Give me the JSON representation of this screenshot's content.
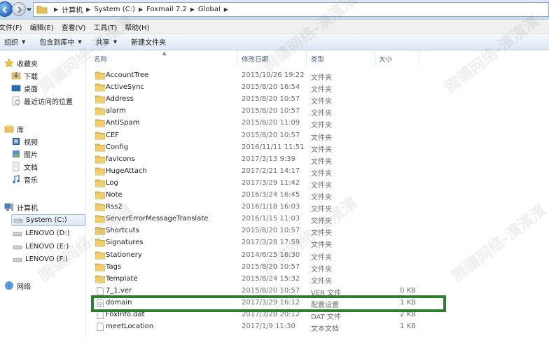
{
  "address": {
    "crumbs": [
      "计算机",
      "System (C:)",
      "Foxmail 7.2",
      "Global"
    ]
  },
  "menu": {
    "items": [
      "文件(F)",
      "编辑(E)",
      "查看(V)",
      "工具(T)",
      "帮助(H)"
    ]
  },
  "toolbar": {
    "organize": "组织",
    "include_library": "包含到库中",
    "share": "共享",
    "new_folder": "新建文件夹"
  },
  "nav": {
    "favorites": "收藏夹",
    "downloads": "下载",
    "desktop": "桌面",
    "recent": "最近访问的位置",
    "libraries": "库",
    "videos": "视频",
    "pictures": "图片",
    "documents": "文档",
    "music": "音乐",
    "computer": "计算机",
    "drive_c": "System (C:)",
    "drive_d": "LENOVO (D:)",
    "drive_e": "LENOVO (E:)",
    "drive_f": "LENOVO (F:)",
    "network": "网络"
  },
  "columns": {
    "name": "名称",
    "modified": "修改日期",
    "type": "类型",
    "size": "大小"
  },
  "files": [
    {
      "name": "AccountTree",
      "date": "2015/10/26 19:22",
      "type": "文件夹",
      "size": "",
      "kind": "folder"
    },
    {
      "name": "ActiveSync",
      "date": "2015/8/20 16:54",
      "type": "文件夹",
      "size": "",
      "kind": "folder"
    },
    {
      "name": "Address",
      "date": "2015/8/20 10:57",
      "type": "文件夹",
      "size": "",
      "kind": "folder"
    },
    {
      "name": "alarm",
      "date": "2015/8/20 10:57",
      "type": "文件夹",
      "size": "",
      "kind": "folder"
    },
    {
      "name": "AntiSpam",
      "date": "2015/8/20 11:09",
      "type": "文件夹",
      "size": "",
      "kind": "folder"
    },
    {
      "name": "CEF",
      "date": "2015/8/20 10:57",
      "type": "文件夹",
      "size": "",
      "kind": "folder"
    },
    {
      "name": "Config",
      "date": "2016/11/11 11:51",
      "type": "文件夹",
      "size": "",
      "kind": "folder"
    },
    {
      "name": "favIcons",
      "date": "2017/3/13 9:39",
      "type": "文件夹",
      "size": "",
      "kind": "folder"
    },
    {
      "name": "HugeAttach",
      "date": "2017/2/21 14:17",
      "type": "文件夹",
      "size": "",
      "kind": "folder"
    },
    {
      "name": "Log",
      "date": "2017/3/29 11:42",
      "type": "文件夹",
      "size": "",
      "kind": "folder"
    },
    {
      "name": "Note",
      "date": "2016/3/24 16:45",
      "type": "文件夹",
      "size": "",
      "kind": "folder"
    },
    {
      "name": "Rss2",
      "date": "2016/1/18 16:03",
      "type": "文件夹",
      "size": "",
      "kind": "folder"
    },
    {
      "name": "ServerErrorMessageTranslate",
      "date": "2016/1/15 11:03",
      "type": "文件夹",
      "size": "",
      "kind": "folder"
    },
    {
      "name": "Shortcuts",
      "date": "2015/8/20 10:57",
      "type": "文件夹",
      "size": "",
      "kind": "folder"
    },
    {
      "name": "Signatures",
      "date": "2017/3/28 17:59",
      "type": "文件夹",
      "size": "",
      "kind": "folder"
    },
    {
      "name": "Stationery",
      "date": "2014/6/25 16:30",
      "type": "文件夹",
      "size": "",
      "kind": "folder"
    },
    {
      "name": "Tags",
      "date": "2015/8/20 10:57",
      "type": "文件夹",
      "size": "",
      "kind": "folder"
    },
    {
      "name": "Template",
      "date": "2015/8/24 15:32",
      "type": "文件夹",
      "size": "",
      "kind": "folder"
    },
    {
      "name": "7_1.ver",
      "date": "2015/8/20 10:57",
      "type": "VER 文件",
      "size": "0 KB",
      "kind": "file"
    },
    {
      "name": "domain",
      "date": "2017/3/29 16:12",
      "type": "配置设置",
      "size": "1 KB",
      "kind": "config"
    },
    {
      "name": "FoxInfo.dat",
      "date": "2017/3/28 20:12",
      "type": "DAT 文件",
      "size": "2 KB",
      "kind": "file"
    },
    {
      "name": "meetLocation",
      "date": "2017/1/9 11:30",
      "type": "文本文档",
      "size": "1 KB",
      "kind": "file"
    }
  ],
  "watermark": "腾骧网络-濱濱濱",
  "colors": {
    "highlight": "#2f7d32",
    "folder": "#e8c15a"
  }
}
